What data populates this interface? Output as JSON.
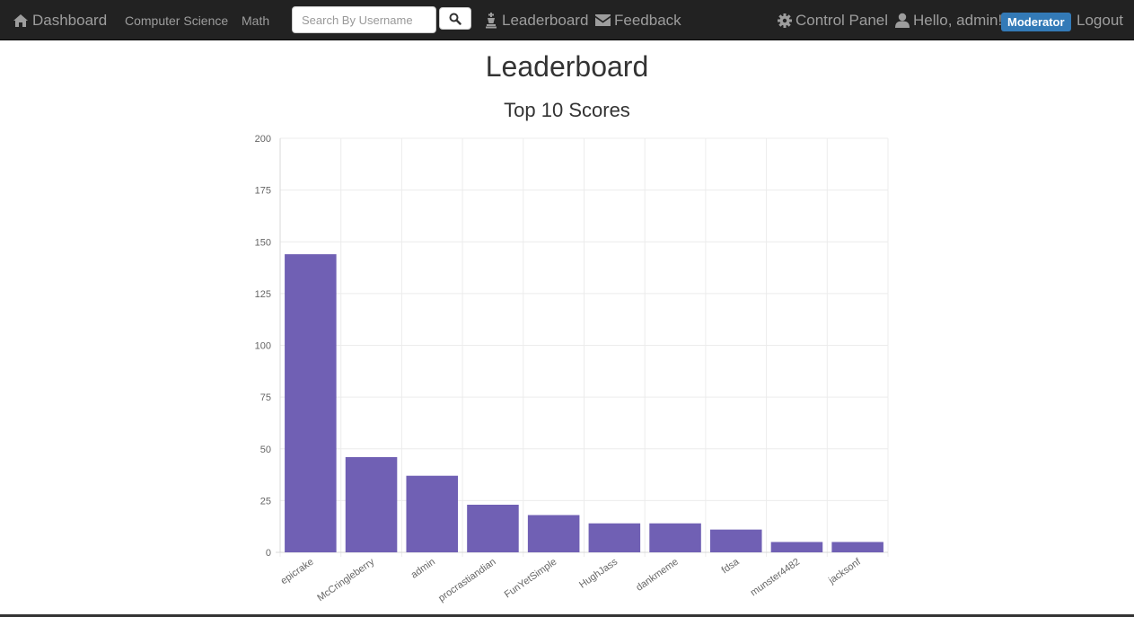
{
  "navbar": {
    "brand_label": "Dashboard",
    "brand_icon": "home-icon",
    "links": {
      "computer_science": "Computer Science",
      "math": "Math"
    },
    "search": {
      "placeholder": "Search By Username",
      "value": ""
    },
    "leaderboard_label": "Leaderboard",
    "feedback_label": "Feedback",
    "control_panel_label": "Control Panel",
    "greeting": "Hello, admin!",
    "role_badge": "Moderator",
    "logout_label": "Logout",
    "colors": {
      "background": "#222222",
      "text": "#9d9d9d",
      "badge": "#337ab7"
    }
  },
  "page": {
    "title": "Leaderboard"
  },
  "chart_data": {
    "type": "bar",
    "title": "Top 10 Scores",
    "xlabel": "",
    "ylabel": "",
    "categories": [
      "epicrake",
      "McCringleberry",
      "admin",
      "procrastiandian",
      "FunYetSimple",
      "HughJass",
      "dankmeme",
      "fdsa",
      "munster4482",
      "jacksonf"
    ],
    "values": [
      144,
      46,
      37,
      23,
      18,
      14,
      14,
      11,
      5,
      5
    ],
    "ylim": [
      0,
      200
    ],
    "yticks": [
      0,
      25,
      50,
      75,
      100,
      125,
      150,
      175,
      200
    ],
    "grid": true,
    "bar_color": "#7060b4"
  }
}
